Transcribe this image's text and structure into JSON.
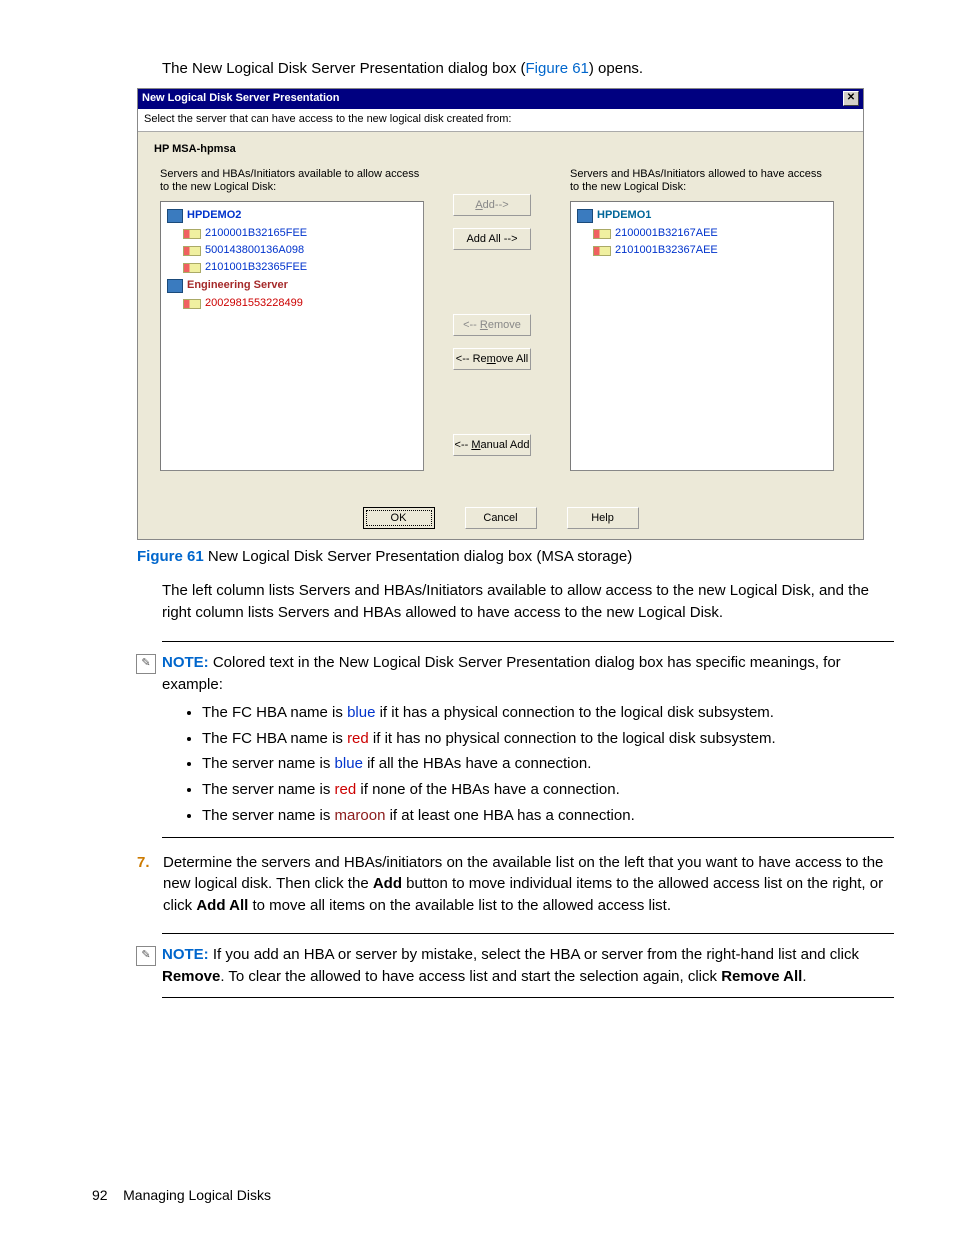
{
  "intro": {
    "pre": "The New Logical Disk Server Presentation dialog box (",
    "figref": "Figure 61",
    "post": ") opens."
  },
  "dialog": {
    "title": "New Logical Disk Server Presentation",
    "close_glyph": "✕",
    "select_text": "Select the server that can have access to the new logical disk created from:",
    "device": "HP MSA-hpmsa",
    "avail_caption": "Servers and HBAs/Initiators available to allow access to the new Logical Disk:",
    "allowed_caption": "Servers and HBAs/Initiators allowed to have access to the new Logical Disk:",
    "avail": {
      "srv1": "HPDEMO2",
      "srv1_h1": "2100001B32165FEE",
      "srv1_h2": "500143800136A098",
      "srv1_h3": "2101001B32365FEE",
      "srv2": "Engineering Server",
      "srv2_h1": "2002981553228499"
    },
    "allowed": {
      "srv1": "HPDEMO1",
      "srv1_h1": "2100001B32167AEE",
      "srv1_h2": "2101001B32367AEE"
    },
    "buttons": {
      "add_pre": "A",
      "add_post": "dd-->",
      "addall_label": "Add All -->",
      "remove_pre": "<-- ",
      "remove_u": "R",
      "remove_post": "emove",
      "removeall_pre": "<-- Re",
      "removeall_u": "m",
      "removeall_post": "ove All",
      "manual_pre": "<-- ",
      "manual_u": "M",
      "manual_post": "anual Add",
      "ok": "OK",
      "cancel": "Cancel",
      "help": "Help"
    }
  },
  "fig_cap": {
    "label": "Figure 61",
    "text": "  New Logical Disk Server Presentation dialog box (MSA storage)"
  },
  "lr_para": "The left column lists Servers and HBAs/Initiators available to allow access to the new Logical Disk, and the right column lists Servers and HBAs allowed to have access to the new Logical Disk.",
  "note1": {
    "label": "NOTE:",
    "text": "   Colored text in the New Logical Disk Server Presentation dialog box has specific meanings, for example:"
  },
  "bullets": {
    "b1a": "The FC HBA name is ",
    "b1c": "blue",
    "b1b": " if it has a physical connection to the logical disk subsystem.",
    "b2a": "The FC HBA name is ",
    "b2c": "red",
    "b2b": " if it has no physical connection to the logical disk subsystem.",
    "b3a": "The server name is ",
    "b3c": "blue",
    "b3b": " if all the HBAs have a connection.",
    "b4a": "The server name is ",
    "b4c": "red",
    "b4b": " if none of the HBAs have a connection.",
    "b5a": "The server name is ",
    "b5c": "maroon",
    "b5b": " if at least one HBA has a connection."
  },
  "step7": {
    "num": "7.",
    "t1": "Determine the servers and HBAs/initiators on the available list on the left that you want to have access to the new logical disk. Then click the ",
    "add": "Add",
    "t2": " button to move individual items to the allowed access list on the right, or click ",
    "addall": "Add All",
    "t3": " to move all items on the available list to the allowed access list."
  },
  "note2": {
    "label": "NOTE:",
    "t1": "   If you add an HBA or server by mistake, select the HBA or server from the right-hand list and click ",
    "remove": "Remove",
    "t2": ". To clear the allowed to have access list and start the selection again, click ",
    "removeall": "Remove All",
    "t3": "."
  },
  "footer": {
    "page": "92",
    "section": "Managing Logical Disks"
  }
}
